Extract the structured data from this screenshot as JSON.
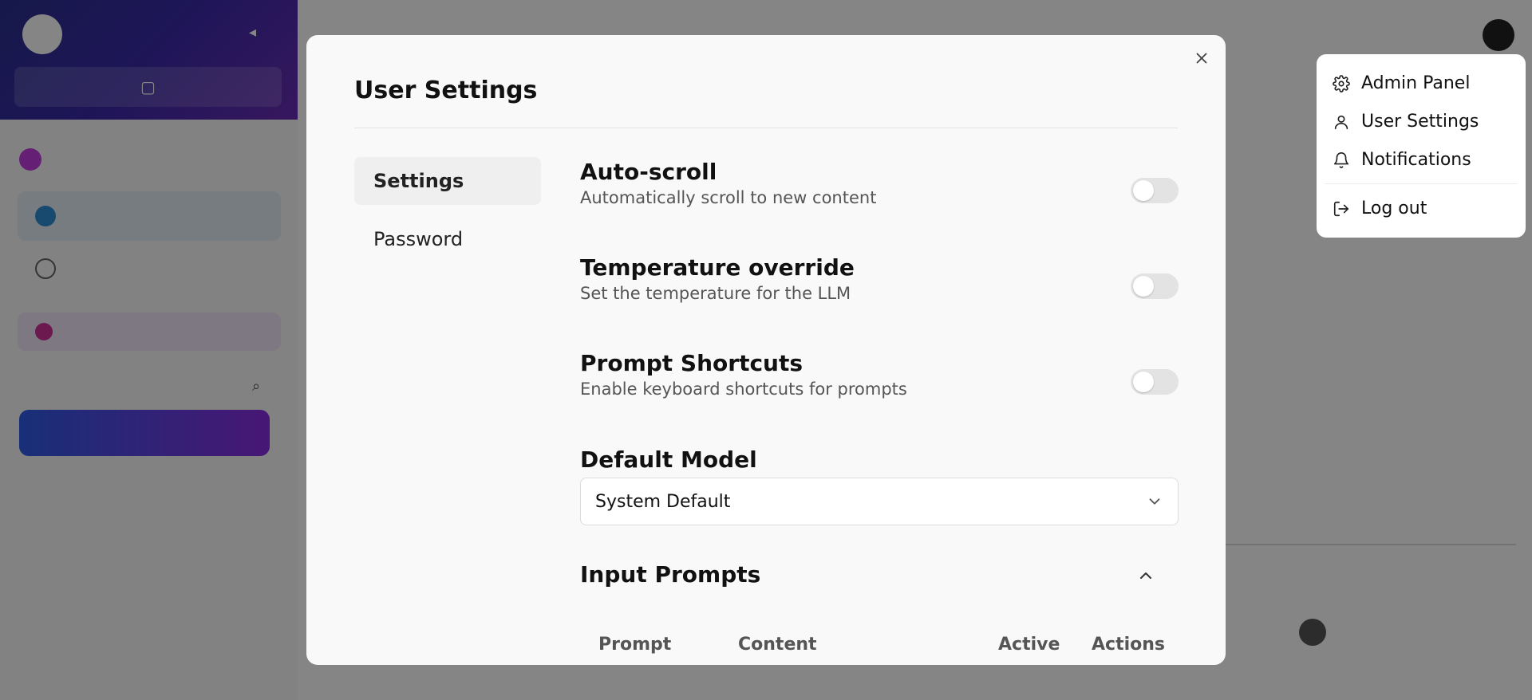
{
  "modal": {
    "title": "User Settings",
    "nav": [
      {
        "label": "Settings",
        "active": true
      },
      {
        "label": "Password",
        "active": false
      }
    ],
    "settings": [
      {
        "title": "Auto-scroll",
        "description": "Automatically scroll to new content",
        "enabled": false
      },
      {
        "title": "Temperature override",
        "description": "Set the temperature for the LLM",
        "enabled": false
      },
      {
        "title": "Prompt Shortcuts",
        "description": "Enable keyboard shortcuts for prompts",
        "enabled": false
      }
    ],
    "default_model": {
      "label": "Default Model",
      "value": "System Default"
    },
    "input_prompts": {
      "title": "Input Prompts",
      "columns": [
        "Prompt",
        "Content",
        "Active",
        "Actions"
      ]
    }
  },
  "menu": {
    "items": [
      {
        "label": "Admin Panel",
        "icon": "gear-icon"
      },
      {
        "label": "User Settings",
        "icon": "user-icon"
      },
      {
        "label": "Notifications",
        "icon": "bell-icon"
      },
      {
        "label": "Log out",
        "icon": "logout-icon"
      }
    ]
  },
  "colors": {
    "overlay": "rgba(0,0,0,0.48)",
    "modal_bg": "#f9f9f9",
    "toggle_off": "#e3e3e3",
    "brand_gradient_start": "#2f5be8",
    "brand_gradient_end": "#8a2ce0"
  }
}
